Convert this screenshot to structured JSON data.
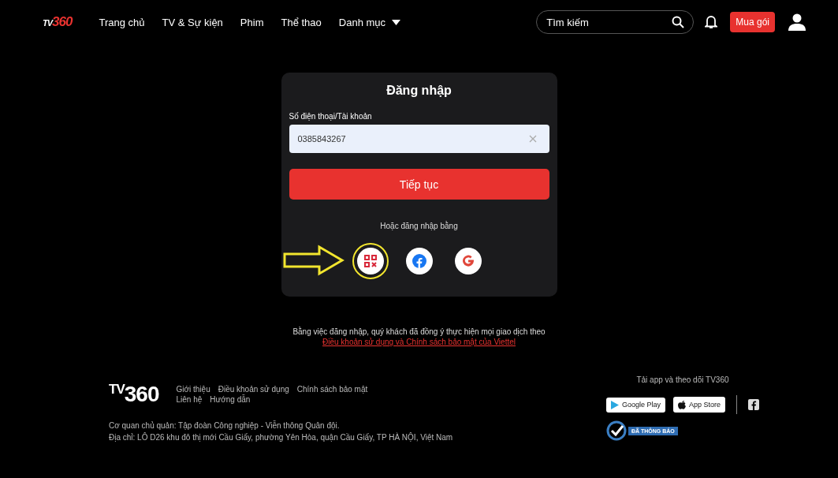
{
  "header": {
    "logo": {
      "prefix": "TV",
      "suffix": "360"
    },
    "nav": [
      {
        "label": "Trang chủ"
      },
      {
        "label": "TV & Sự kiện"
      },
      {
        "label": "Phim"
      },
      {
        "label": "Thể thao"
      },
      {
        "label": "Danh mục",
        "dropdown": true
      }
    ],
    "search": {
      "placeholder": "Tìm kiếm"
    },
    "buy_button": "Mua gói"
  },
  "login": {
    "title": "Đăng nhập",
    "field_label": "Số điện thoại/Tài khoản",
    "field_value": "0385843267",
    "continue_button": "Tiếp tục",
    "alt_text": "Hoặc đăng nhập bằng",
    "options": [
      {
        "kind": "qr",
        "highlighted": true
      },
      {
        "kind": "facebook",
        "highlighted": false
      },
      {
        "kind": "google",
        "highlighted": false
      }
    ]
  },
  "terms": {
    "text": "Bằng việc đăng nhập, quý khách đã đồng ý thực hiện mọi giao dịch theo",
    "link": "Điều khoản sử dụng và Chính sách bảo mật của Viettel"
  },
  "footer": {
    "logo": {
      "prefix": "TV",
      "suffix": "360"
    },
    "links": [
      "Giới thiệu",
      "Điều khoản sử dụng",
      "Chính sách bảo mật",
      "Liên hệ",
      "Hướng dẫn"
    ],
    "lines": [
      "Cơ quan chủ quản: Tập đoàn Công nghiệp - Viễn thông Quân đội.",
      "Địa chỉ: LÔ D26 khu đô thị mới Cầu Giấy, phường Yên Hòa, quận Cầu Giấy, TP HÀ NỘI, Việt Nam"
    ],
    "app_title": "Tải app và theo dõi TV360",
    "stores": [
      "Google Play",
      "App Store"
    ],
    "badge": "ĐÃ THÔNG BÁO"
  }
}
